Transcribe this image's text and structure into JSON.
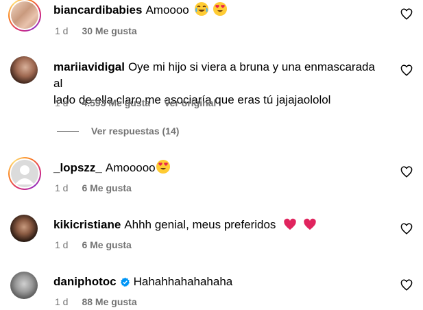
{
  "comments": [
    {
      "username": "biancardibabies",
      "text": "Amoooo",
      "emojis": [
        "laughing-tears-emoji",
        "heart-eyes-emoji"
      ],
      "time": "1 d",
      "likes": "30 Me gusta"
    },
    {
      "username": "mariiavidigal",
      "text_line1": "Oye mi hijo si viera a bruna y una enmascarada al",
      "text_line2": "lado de ella claro me asociaría que eras tú jajajaololol",
      "time": "1 d",
      "likes": "4.593 Me gusta",
      "translate": "Ver original"
    },
    {
      "username": "_lopszz_",
      "text": "Amooooo",
      "emojis": [
        "heart-eyes-emoji"
      ],
      "time": "1 d",
      "likes": "6 Me gusta"
    },
    {
      "username": "kikicristiane",
      "text": "Ahhh genial, meus preferidos",
      "emojis": [
        "pink-heart-emoji",
        "pink-heart-emoji"
      ],
      "time": "1 d",
      "likes": "6 Me gusta"
    },
    {
      "username": "daniphotoc",
      "verified": true,
      "text": "Hahahhahahahaha",
      "time": "1 d",
      "likes": "88 Me gusta"
    }
  ],
  "replies_label": "Ver respuestas (14)",
  "colors": {
    "meta": "#737373",
    "verified": "#0095f6",
    "heart_emoji": "#e0245e"
  }
}
